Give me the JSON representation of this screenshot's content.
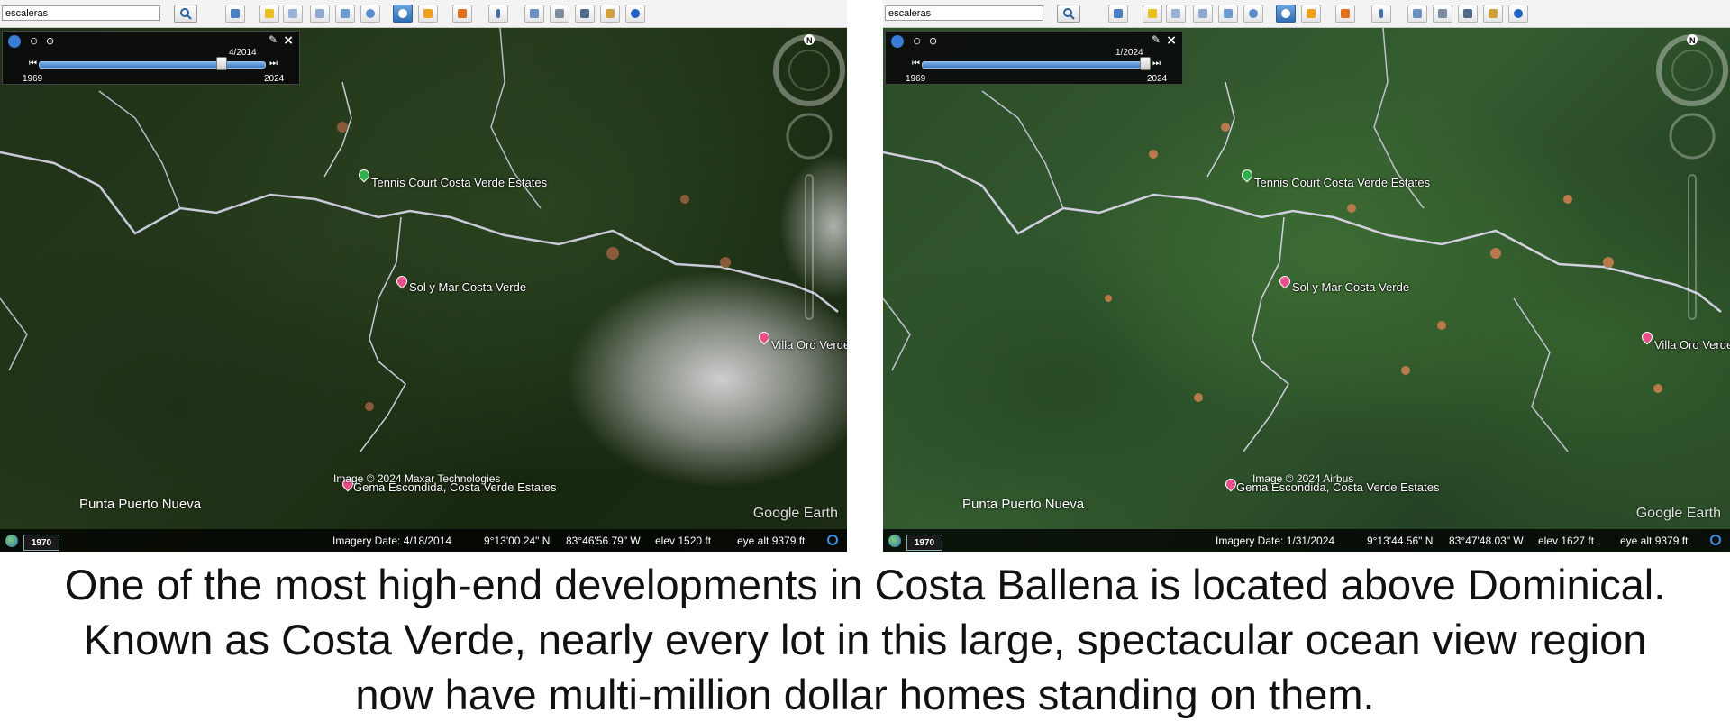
{
  "panels": [
    {
      "search": {
        "value": "escaleras"
      },
      "time_slider": {
        "current_date": "4/2014",
        "start_year": "1969",
        "end_year": "2024",
        "position": 0.81
      },
      "places": {
        "tennis": "Tennis Court Costa Verde Estates",
        "sol": "Sol y Mar Costa Verde",
        "villa": "Villa Oro Verde",
        "gema": "Gema Escondida, Costa Verde Estates",
        "punta": "Punta Puerto Nueva"
      },
      "credit": "Image © 2024 Maxar Technologies",
      "brand": "Google Earth",
      "status": {
        "badge": "1970",
        "imagery_date": "Imagery Date: 4/18/2014",
        "lat": "9°13'00.24\" N",
        "lon": "83°46'56.79\" W",
        "elev": "elev  1520 ft",
        "eye_alt": "eye alt  9379 ft"
      }
    },
    {
      "search": {
        "value": "escaleras"
      },
      "time_slider": {
        "current_date": "1/2024",
        "start_year": "1969",
        "end_year": "2024",
        "position": 0.99
      },
      "places": {
        "tennis": "Tennis Court Costa Verde Estates",
        "sol": "Sol y Mar Costa Verde",
        "villa": "Villa Oro Verde",
        "gema": "Gema Escondida, Costa Verde Estates",
        "punta": "Punta Puerto Nueva"
      },
      "credit": "Image © 2024 Airbus",
      "brand": "Google Earth",
      "status": {
        "badge": "1970",
        "imagery_date": "Imagery Date: 1/31/2024",
        "lat": "9°13'44.56\" N",
        "lon": "83°47'48.03\" W",
        "elev": "elev  1627 ft",
        "eye_alt": "eye alt  9379 ft"
      }
    }
  ],
  "icons": {
    "toolbar": [
      "sidebar-toggle-icon",
      "placemark-icon",
      "polygon-icon",
      "path-icon",
      "image-overlay-icon",
      "record-tour-icon",
      "historical-imagery-icon",
      "sunlight-icon",
      "switch-to-sky-icon",
      "ruler-icon",
      "email-icon",
      "print-icon",
      "save-image-icon",
      "view-in-maps-icon",
      "earth-gallery-icon"
    ]
  },
  "caption": {
    "line1": "One of the most high-end developments in Costa Ballena is located above Dominical.",
    "line2": "Known as Costa Verde, nearly every lot in this large, spectacular ocean view region",
    "line3": "now have multi-million dollar homes standing on them."
  },
  "colors": {
    "pin_green": "#2fae4b",
    "pin_pink": "#e6508a",
    "slider_blue": "#3c78c2"
  }
}
